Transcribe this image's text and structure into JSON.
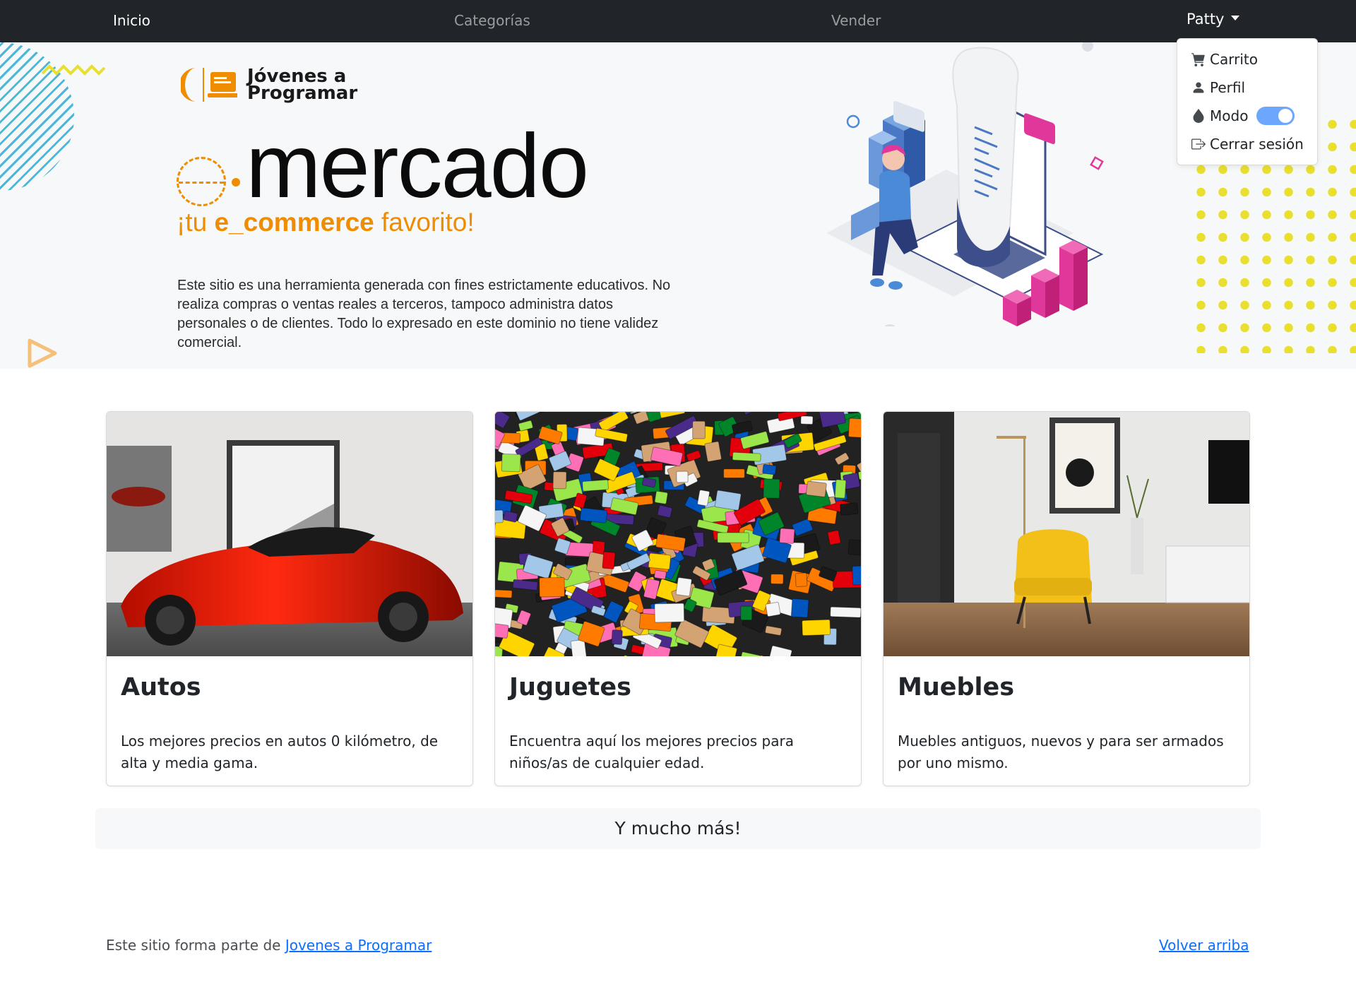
{
  "nav": {
    "inicio": "Inicio",
    "categorias": "Categorías",
    "vender": "Vender",
    "user": "Patty"
  },
  "dropdown": {
    "carrito": "Carrito",
    "perfil": "Perfil",
    "modo": "Modo",
    "cerrar": "Cerrar sesión",
    "modo_enabled": true
  },
  "hero": {
    "brand_line1": "Jóvenes a",
    "brand_line2": "Programar",
    "title": "mercado",
    "tagline_pre": "¡tu ",
    "tagline_bold": "e_commerce",
    "tagline_post": " favorito!",
    "disclaimer": "Este sitio es una herramienta generada con fines estrictamente educativos. No realiza compras o ventas reales a terceros, tampoco administra datos personales o de clientes. Todo lo expresado en este dominio no tiene validez comercial.",
    "accent_color": "#f08c00"
  },
  "cards": [
    {
      "title": "Autos",
      "text": "Los mejores precios en autos 0 kilómetro, de alta y media gama."
    },
    {
      "title": "Juguetes",
      "text": "Encuentra aquí los mejores precios para niños/as de cualquier edad."
    },
    {
      "title": "Muebles",
      "text": "Muebles antiguos, nuevos y para ser armados por uno mismo."
    }
  ],
  "more": "Y mucho más!",
  "footer": {
    "text": "Este sitio forma parte de ",
    "link": "Jovenes a Programar",
    "back_top": "Volver arriba"
  }
}
